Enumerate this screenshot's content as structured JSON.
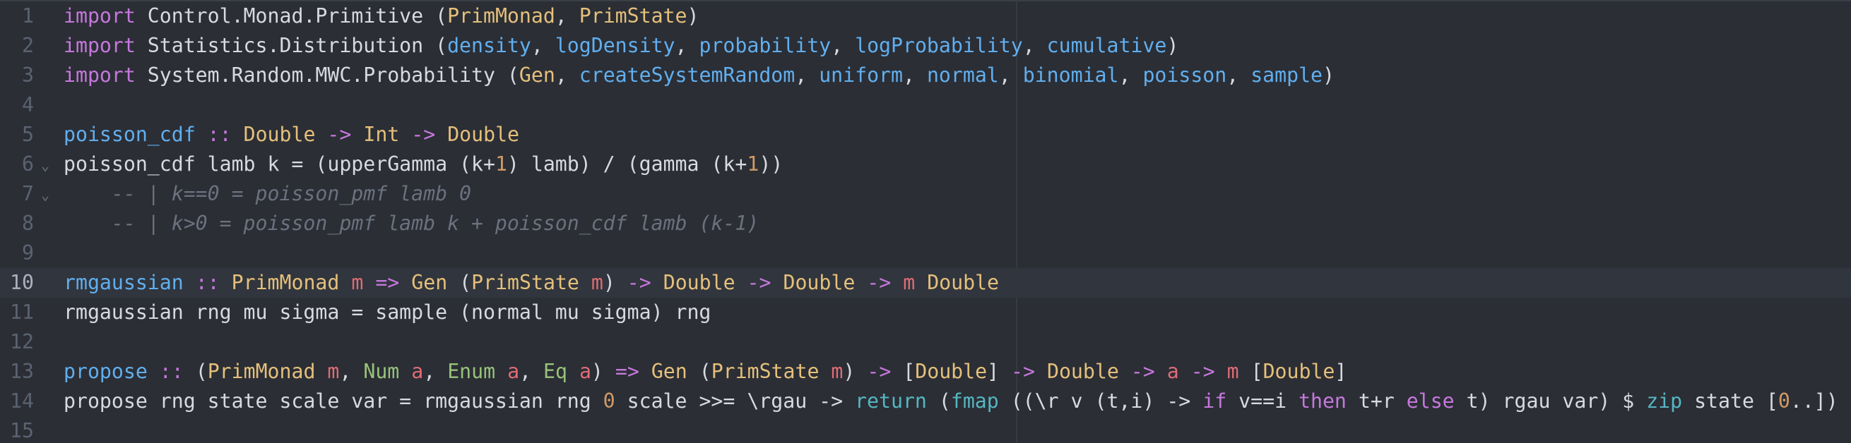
{
  "editor": {
    "language": "haskell",
    "active_line": 10,
    "folds": [
      {
        "line": 6,
        "glyph": "⌄"
      },
      {
        "line": 7,
        "glyph": "⌄"
      }
    ],
    "lines": [
      {
        "n": "1",
        "tokens": [
          {
            "t": "import",
            "c": "kw"
          },
          {
            "t": " Control.Monad.Primitive (",
            "c": "pl"
          },
          {
            "t": "PrimMonad",
            "c": "ty"
          },
          {
            "t": ", ",
            "c": "pl"
          },
          {
            "t": "PrimState",
            "c": "ty"
          },
          {
            "t": ")",
            "c": "pl"
          }
        ]
      },
      {
        "n": "2",
        "tokens": [
          {
            "t": "import",
            "c": "kw"
          },
          {
            "t": " Statistics.Distribution (",
            "c": "pl"
          },
          {
            "t": "density",
            "c": "fn"
          },
          {
            "t": ", ",
            "c": "pl"
          },
          {
            "t": "logDensity",
            "c": "fn"
          },
          {
            "t": ", ",
            "c": "pl"
          },
          {
            "t": "probability",
            "c": "fn"
          },
          {
            "t": ", ",
            "c": "pl"
          },
          {
            "t": "logProbability",
            "c": "fn"
          },
          {
            "t": ", ",
            "c": "pl"
          },
          {
            "t": "cumulative",
            "c": "fn"
          },
          {
            "t": ")",
            "c": "pl"
          }
        ]
      },
      {
        "n": "3",
        "tokens": [
          {
            "t": "import",
            "c": "kw"
          },
          {
            "t": " System.Random.MWC.Probability (",
            "c": "pl"
          },
          {
            "t": "Gen",
            "c": "ty"
          },
          {
            "t": ", ",
            "c": "pl"
          },
          {
            "t": "createSystemRandom",
            "c": "fn"
          },
          {
            "t": ", ",
            "c": "pl"
          },
          {
            "t": "uniform",
            "c": "fn"
          },
          {
            "t": ", ",
            "c": "pl"
          },
          {
            "t": "normal",
            "c": "fn"
          },
          {
            "t": ", ",
            "c": "pl"
          },
          {
            "t": "binomial",
            "c": "fn"
          },
          {
            "t": ", ",
            "c": "pl"
          },
          {
            "t": "poisson",
            "c": "fn"
          },
          {
            "t": ", ",
            "c": "pl"
          },
          {
            "t": "sample",
            "c": "fn"
          },
          {
            "t": ")",
            "c": "pl"
          }
        ]
      },
      {
        "n": "4",
        "tokens": []
      },
      {
        "n": "5",
        "tokens": [
          {
            "t": "poisson_cdf",
            "c": "fn"
          },
          {
            "t": " ",
            "c": "pl"
          },
          {
            "t": "::",
            "c": "op"
          },
          {
            "t": " ",
            "c": "pl"
          },
          {
            "t": "Double",
            "c": "ty"
          },
          {
            "t": " ",
            "c": "pl"
          },
          {
            "t": "->",
            "c": "op"
          },
          {
            "t": " ",
            "c": "pl"
          },
          {
            "t": "Int",
            "c": "ty"
          },
          {
            "t": " ",
            "c": "pl"
          },
          {
            "t": "->",
            "c": "op"
          },
          {
            "t": " ",
            "c": "pl"
          },
          {
            "t": "Double",
            "c": "ty"
          }
        ]
      },
      {
        "n": "6",
        "tokens": [
          {
            "t": "poisson_cdf lamb k = (upperGamma (k+",
            "c": "pl"
          },
          {
            "t": "1",
            "c": "num"
          },
          {
            "t": ") lamb) / (gamma (k+",
            "c": "pl"
          },
          {
            "t": "1",
            "c": "num"
          },
          {
            "t": "))",
            "c": "pl"
          }
        ]
      },
      {
        "n": "7",
        "tokens": [
          {
            "t": "    -- | k==0 = poisson_pmf lamb 0",
            "c": "cm"
          }
        ]
      },
      {
        "n": "8",
        "tokens": [
          {
            "t": "    -- | k>0 = poisson_pmf lamb k + poisson_cdf lamb (k-1)",
            "c": "cm"
          }
        ]
      },
      {
        "n": "9",
        "tokens": []
      },
      {
        "n": "10",
        "tokens": [
          {
            "t": "rmgaussian",
            "c": "fn"
          },
          {
            "t": " ",
            "c": "pl"
          },
          {
            "t": "::",
            "c": "op"
          },
          {
            "t": " ",
            "c": "pl"
          },
          {
            "t": "PrimMonad",
            "c": "ty"
          },
          {
            "t": " ",
            "c": "pl"
          },
          {
            "t": "m",
            "c": "tv"
          },
          {
            "t": " ",
            "c": "pl"
          },
          {
            "t": "=>",
            "c": "op"
          },
          {
            "t": " ",
            "c": "pl"
          },
          {
            "t": "Gen",
            "c": "ty"
          },
          {
            "t": " (",
            "c": "pl"
          },
          {
            "t": "PrimState",
            "c": "ty"
          },
          {
            "t": " ",
            "c": "pl"
          },
          {
            "t": "m",
            "c": "tv"
          },
          {
            "t": ") ",
            "c": "pl"
          },
          {
            "t": "->",
            "c": "op"
          },
          {
            "t": " ",
            "c": "pl"
          },
          {
            "t": "Double",
            "c": "ty"
          },
          {
            "t": " ",
            "c": "pl"
          },
          {
            "t": "->",
            "c": "op"
          },
          {
            "t": " ",
            "c": "pl"
          },
          {
            "t": "Double",
            "c": "ty"
          },
          {
            "t": " ",
            "c": "pl"
          },
          {
            "t": "->",
            "c": "op"
          },
          {
            "t": " ",
            "c": "pl"
          },
          {
            "t": "m",
            "c": "tv"
          },
          {
            "t": " ",
            "c": "pl"
          },
          {
            "t": "Double",
            "c": "ty"
          }
        ]
      },
      {
        "n": "11",
        "tokens": [
          {
            "t": "rmgaussian rng mu sigma = sample (normal mu sigma) rng",
            "c": "pl"
          }
        ]
      },
      {
        "n": "12",
        "tokens": []
      },
      {
        "n": "13",
        "tokens": [
          {
            "t": "propose",
            "c": "fn"
          },
          {
            "t": " ",
            "c": "pl"
          },
          {
            "t": "::",
            "c": "op"
          },
          {
            "t": " (",
            "c": "pl"
          },
          {
            "t": "PrimMonad",
            "c": "ty"
          },
          {
            "t": " ",
            "c": "pl"
          },
          {
            "t": "m",
            "c": "tv"
          },
          {
            "t": ", ",
            "c": "pl"
          },
          {
            "t": "Num",
            "c": "cls"
          },
          {
            "t": " ",
            "c": "pl"
          },
          {
            "t": "a",
            "c": "tv"
          },
          {
            "t": ", ",
            "c": "pl"
          },
          {
            "t": "Enum",
            "c": "cls"
          },
          {
            "t": " ",
            "c": "pl"
          },
          {
            "t": "a",
            "c": "tv"
          },
          {
            "t": ", ",
            "c": "pl"
          },
          {
            "t": "Eq",
            "c": "cls"
          },
          {
            "t": " ",
            "c": "pl"
          },
          {
            "t": "a",
            "c": "tv"
          },
          {
            "t": ") ",
            "c": "pl"
          },
          {
            "t": "=>",
            "c": "op"
          },
          {
            "t": " ",
            "c": "pl"
          },
          {
            "t": "Gen",
            "c": "ty"
          },
          {
            "t": " (",
            "c": "pl"
          },
          {
            "t": "PrimState",
            "c": "ty"
          },
          {
            "t": " ",
            "c": "pl"
          },
          {
            "t": "m",
            "c": "tv"
          },
          {
            "t": ") ",
            "c": "pl"
          },
          {
            "t": "->",
            "c": "op"
          },
          {
            "t": " [",
            "c": "pl"
          },
          {
            "t": "Double",
            "c": "ty"
          },
          {
            "t": "] ",
            "c": "pl"
          },
          {
            "t": "->",
            "c": "op"
          },
          {
            "t": " ",
            "c": "pl"
          },
          {
            "t": "Double",
            "c": "ty"
          },
          {
            "t": " ",
            "c": "pl"
          },
          {
            "t": "->",
            "c": "op"
          },
          {
            "t": " ",
            "c": "pl"
          },
          {
            "t": "a",
            "c": "tv"
          },
          {
            "t": " ",
            "c": "pl"
          },
          {
            "t": "->",
            "c": "op"
          },
          {
            "t": " ",
            "c": "pl"
          },
          {
            "t": "m",
            "c": "tv"
          },
          {
            "t": " [",
            "c": "pl"
          },
          {
            "t": "Double",
            "c": "ty"
          },
          {
            "t": "]",
            "c": "pl"
          }
        ]
      },
      {
        "n": "14",
        "tokens": [
          {
            "t": "propose rng state scale var = rmgaussian rng ",
            "c": "pl"
          },
          {
            "t": "0",
            "c": "num"
          },
          {
            "t": " scale >>= \\rgau -> ",
            "c": "pl"
          },
          {
            "t": "return",
            "c": "bi"
          },
          {
            "t": " (",
            "c": "pl"
          },
          {
            "t": "fmap",
            "c": "bi"
          },
          {
            "t": " ((\\r v (t,i) -> ",
            "c": "pl"
          },
          {
            "t": "if",
            "c": "kw"
          },
          {
            "t": " v==i ",
            "c": "pl"
          },
          {
            "t": "then",
            "c": "kw"
          },
          {
            "t": " t+r ",
            "c": "pl"
          },
          {
            "t": "else",
            "c": "kw"
          },
          {
            "t": " t) rgau var) $ ",
            "c": "pl"
          },
          {
            "t": "zip",
            "c": "bi"
          },
          {
            "t": " state [",
            "c": "pl"
          },
          {
            "t": "0",
            "c": "num"
          },
          {
            "t": "..])",
            "c": "pl"
          }
        ]
      },
      {
        "n": "15",
        "tokens": []
      }
    ]
  }
}
